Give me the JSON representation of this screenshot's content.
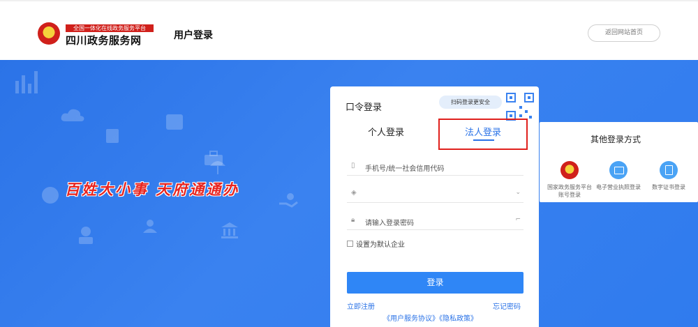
{
  "header": {
    "brand_tag": "全国一体化在线政务服务平台",
    "brand_name": "四川政务服务网",
    "page_title": "用户登录",
    "back_link": "返回网站首页"
  },
  "banner": {
    "slogan": "百姓大小事 天府通通办"
  },
  "login": {
    "title": "口令登录",
    "scan_tip": "扫码登录更安全",
    "tabs": [
      "个人登录",
      "法人登录"
    ],
    "active_tab": "法人登录",
    "account_placeholder": "手机号/统一社会信用代码",
    "select_value": "",
    "password_placeholder": "请输入登录密码",
    "default_checkbox": "设置为默认企业",
    "submit": "登录",
    "register": "立即注册",
    "forgot": "忘记密码",
    "agreements": "《用户服务协议》《隐私政策》"
  },
  "other_login": {
    "title": "其他登录方式",
    "options": [
      {
        "label": "国家政务服务平台账号登录",
        "icon": "national-emblem-icon"
      },
      {
        "label": "电子营业执照登录",
        "icon": "business-license-icon"
      },
      {
        "label": "数字证书登录",
        "icon": "digital-certificate-icon"
      }
    ]
  },
  "colors": {
    "primary": "#2b73e7",
    "button": "#2f86f6",
    "highlight": "#e0201c",
    "brand_red": "#d0201b"
  }
}
